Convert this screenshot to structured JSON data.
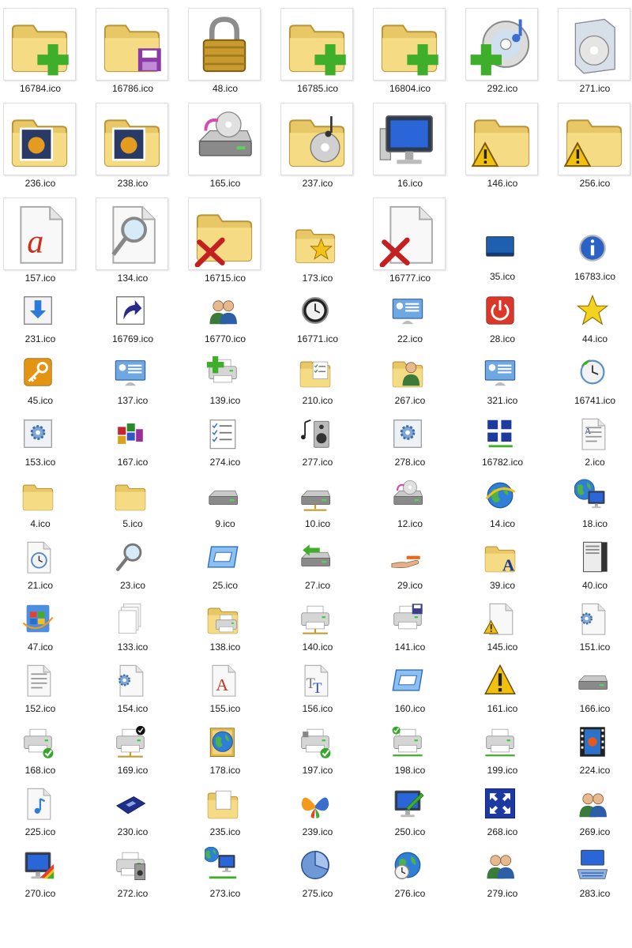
{
  "icons": [
    {
      "label": "16784.ico",
      "icon": "folder-add-icon"
    },
    {
      "label": "16786.ico",
      "icon": "folder-save-icon"
    },
    {
      "label": "48.ico",
      "icon": "padlock-icon"
    },
    {
      "label": "16785.ico",
      "icon": "folder-add-icon"
    },
    {
      "label": "16804.ico",
      "icon": "folder-add-icon"
    },
    {
      "label": "292.ico",
      "icon": "cd-music-add-icon"
    },
    {
      "label": "271.ico",
      "icon": "software-box-icon"
    },
    {
      "label": "236.ico",
      "icon": "folder-pictures-icon"
    },
    {
      "label": "238.ico",
      "icon": "folder-pictures-icon"
    },
    {
      "label": "165.ico",
      "icon": "cd-drive-icon"
    },
    {
      "label": "237.ico",
      "icon": "folder-music-icon"
    },
    {
      "label": "16.ico",
      "icon": "computer-monitor-icon"
    },
    {
      "label": "146.ico",
      "icon": "folder-warning-icon"
    },
    {
      "label": "256.ico",
      "icon": "folder-warning-icon"
    },
    {
      "label": "157.ico",
      "icon": "document-a-icon"
    },
    {
      "label": "134.ico",
      "icon": "document-search-icon"
    },
    {
      "label": "16715.ico",
      "icon": "folder-delete-icon"
    },
    {
      "label": "173.ico",
      "icon": "folder-favorite-icon"
    },
    {
      "label": "16777.ico",
      "icon": "document-delete-icon"
    },
    {
      "label": "35.ico",
      "icon": "desktop-icon"
    },
    {
      "label": "16783.ico",
      "icon": "info-icon"
    },
    {
      "label": "231.ico",
      "icon": "download-arrow-icon"
    },
    {
      "label": "16769.ico",
      "icon": "shortcut-arrow-icon"
    },
    {
      "label": "16770.ico",
      "icon": "users-icon"
    },
    {
      "label": "16771.ico",
      "icon": "clock-icon"
    },
    {
      "label": "22.ico",
      "icon": "control-panel-icon"
    },
    {
      "label": "28.ico",
      "icon": "power-icon"
    },
    {
      "label": "44.ico",
      "icon": "star-icon"
    },
    {
      "label": "45.ico",
      "icon": "key-icon"
    },
    {
      "label": "137.ico",
      "icon": "control-panel-icon"
    },
    {
      "label": "139.ico",
      "icon": "printer-add-icon"
    },
    {
      "label": "210.ico",
      "icon": "folder-checklist-icon"
    },
    {
      "label": "267.ico",
      "icon": "folder-users-icon"
    },
    {
      "label": "321.ico",
      "icon": "control-panel-icon"
    },
    {
      "label": "16741.ico",
      "icon": "clock-restore-icon"
    },
    {
      "label": "153.ico",
      "icon": "settings-window-icon"
    },
    {
      "label": "167.ico",
      "icon": "blocks-icon"
    },
    {
      "label": "274.ico",
      "icon": "checklist-icon"
    },
    {
      "label": "277.ico",
      "icon": "music-speaker-icon"
    },
    {
      "label": "278.ico",
      "icon": "settings-window-icon"
    },
    {
      "label": "16782.ico",
      "icon": "network-windows-icon"
    },
    {
      "label": "2.ico",
      "icon": "document-text-icon"
    },
    {
      "label": "4.ico",
      "icon": "folder-icon"
    },
    {
      "label": "5.ico",
      "icon": "folder-icon"
    },
    {
      "label": "9.ico",
      "icon": "hard-drive-icon"
    },
    {
      "label": "10.ico",
      "icon": "network-drive-icon"
    },
    {
      "label": "12.ico",
      "icon": "cd-drive-icon"
    },
    {
      "label": "14.ico",
      "icon": "internet-globe-icon"
    },
    {
      "label": "18.ico",
      "icon": "globe-computer-icon"
    },
    {
      "label": "21.ico",
      "icon": "document-clock-icon"
    },
    {
      "label": "23.ico",
      "icon": "magnifier-icon"
    },
    {
      "label": "25.ico",
      "icon": "window-frame-icon"
    },
    {
      "label": "27.ico",
      "icon": "drive-arrow-icon"
    },
    {
      "label": "29.ico",
      "icon": "shared-hand-icon"
    },
    {
      "label": "39.ico",
      "icon": "folder-font-icon"
    },
    {
      "label": "40.ico",
      "icon": "server-tower-icon"
    },
    {
      "label": "47.ico",
      "icon": "windows-update-icon"
    },
    {
      "label": "133.ico",
      "icon": "documents-stack-icon"
    },
    {
      "label": "138.ico",
      "icon": "folder-printer-icon"
    },
    {
      "label": "140.ico",
      "icon": "network-printer-icon"
    },
    {
      "label": "141.ico",
      "icon": "printer-save-icon"
    },
    {
      "label": "145.ico",
      "icon": "document-warning-icon"
    },
    {
      "label": "151.ico",
      "icon": "document-settings-icon"
    },
    {
      "label": "152.ico",
      "icon": "document-lines-icon"
    },
    {
      "label": "154.ico",
      "icon": "document-settings-icon"
    },
    {
      "label": "155.ico",
      "icon": "font-a-icon"
    },
    {
      "label": "156.ico",
      "icon": "font-truetype-icon"
    },
    {
      "label": "160.ico",
      "icon": "window-frame-icon"
    },
    {
      "label": "161.ico",
      "icon": "warning-icon"
    },
    {
      "label": "166.ico",
      "icon": "hard-drive-icon"
    },
    {
      "label": "168.ico",
      "icon": "printer-check-icon"
    },
    {
      "label": "169.ico",
      "icon": "network-printer-check-icon"
    },
    {
      "label": "178.ico",
      "icon": "globe-book-icon"
    },
    {
      "label": "197.ico",
      "icon": "fax-check-icon"
    },
    {
      "label": "198.ico",
      "icon": "fax-network-check-icon"
    },
    {
      "label": "199.ico",
      "icon": "fax-network-icon"
    },
    {
      "label": "224.ico",
      "icon": "film-strip-icon"
    },
    {
      "label": "225.ico",
      "icon": "document-music-icon"
    },
    {
      "label": "230.ico",
      "icon": "floppy-disk-icon"
    },
    {
      "label": "235.ico",
      "icon": "folder-open-documents-icon"
    },
    {
      "label": "239.ico",
      "icon": "msn-butterfly-icon"
    },
    {
      "label": "250.ico",
      "icon": "monitor-pen-icon"
    },
    {
      "label": "268.ico",
      "icon": "fullscreen-arrows-icon"
    },
    {
      "label": "269.ico",
      "icon": "users-icon"
    },
    {
      "label": "270.ico",
      "icon": "monitor-colors-icon"
    },
    {
      "label": "272.ico",
      "icon": "printer-speaker-icon"
    },
    {
      "label": "273.ico",
      "icon": "network-computers-icon"
    },
    {
      "label": "275.ico",
      "icon": "pie-chart-icon"
    },
    {
      "label": "276.ico",
      "icon": "globe-clock-icon"
    },
    {
      "label": "279.ico",
      "icon": "users-icon"
    },
    {
      "label": "283.ico",
      "icon": "computer-keyboard-icon"
    }
  ]
}
